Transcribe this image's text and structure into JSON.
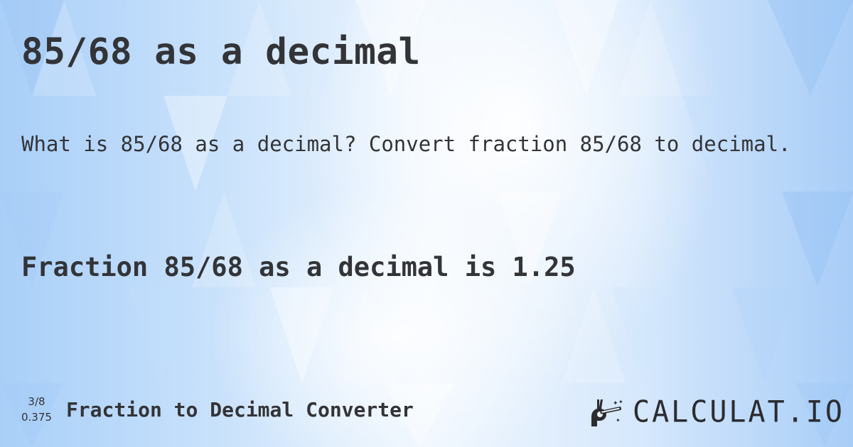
{
  "page": {
    "title": "85/68 as a decimal",
    "question": "What is 85/68 as a decimal? Convert fraction 85/68 to decimal.",
    "answer": "Fraction 85/68 as a decimal is 1.25"
  },
  "footer": {
    "example_fraction": "3/8",
    "example_decimal": "0.375",
    "converter_label": "Fraction to Decimal Converter",
    "brand_icon": "magic-hand-wand-icon",
    "brand_name": "CALCULAT.IO"
  },
  "colors": {
    "text": "#333438",
    "background_light": "#eef6fe",
    "background_blue": "#a9cff8"
  }
}
